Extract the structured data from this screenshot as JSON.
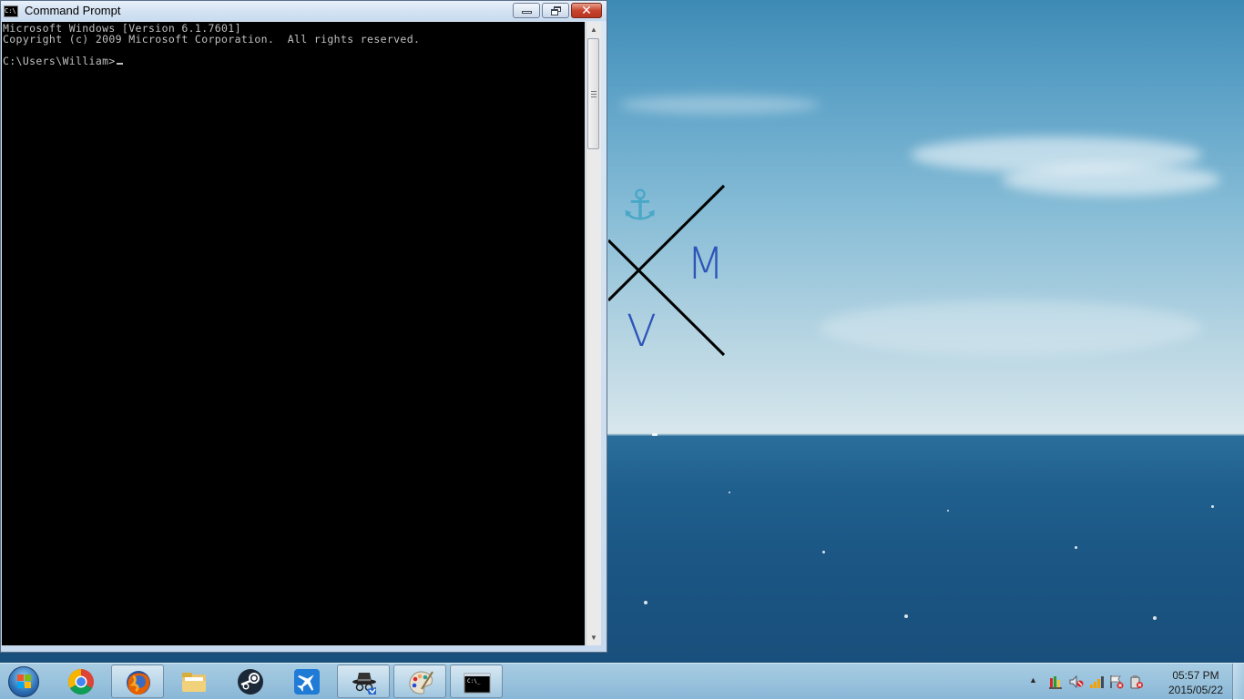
{
  "window": {
    "title": "Command Prompt",
    "minimize_label": "Minimize",
    "maximize_label": "Restore Down",
    "close_symbol": "✕"
  },
  "console": {
    "lines": [
      "Microsoft Windows [Version 6.1.7601]",
      "Copyright (c) 2009 Microsoft Corporation.  All rights reserved.",
      "",
      "C:\\Users\\William>"
    ],
    "background": "#000000",
    "text_color": "#c0c0c0"
  },
  "wallpaper": {
    "logo_letters": [
      "M",
      "V"
    ],
    "logo_icon": "anchor-icon",
    "logo_color": "#2d55b8"
  },
  "taskbar": {
    "start": "start-button",
    "pinned": [
      {
        "name": "chrome",
        "icon": "chrome-icon",
        "active": false
      },
      {
        "name": "firefox",
        "icon": "firefox-icon",
        "active": true
      },
      {
        "name": "file-explorer",
        "icon": "folder-icon",
        "active": false
      },
      {
        "name": "steam",
        "icon": "steam-icon",
        "active": false
      },
      {
        "name": "airplane-app",
        "icon": "airplane-icon",
        "active": false
      },
      {
        "name": "incognito-app",
        "icon": "spy-hat-icon",
        "active": true
      },
      {
        "name": "paint",
        "icon": "paint-palette-icon",
        "active": true
      },
      {
        "name": "command-prompt",
        "icon": "cmd-icon",
        "active": true
      }
    ],
    "tray_icons": [
      "show-hidden-icons",
      "action-center-icon",
      "volume-muted-icon",
      "network-icon",
      "flag-error-icon",
      "power-icon"
    ],
    "clock": {
      "time": "05:57 PM",
      "date": "2015/05/22"
    }
  }
}
